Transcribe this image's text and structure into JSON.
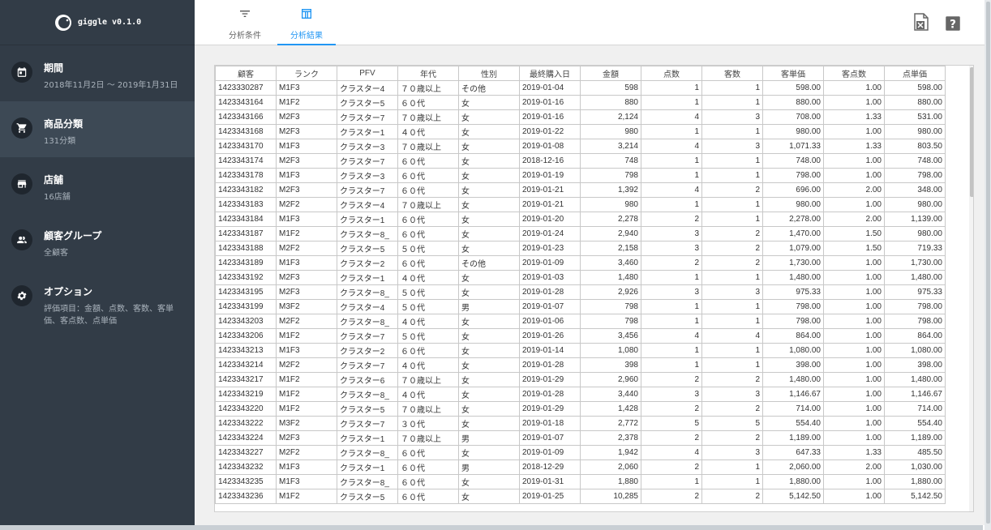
{
  "app": {
    "name": "giggle v0.1.0"
  },
  "sidebar": {
    "items": [
      {
        "label": "期間",
        "sub": "2018年11月2日 ～ 2019年1月31日",
        "icon": "calendar-icon"
      },
      {
        "label": "商品分類",
        "sub": "131分類",
        "icon": "cart-icon"
      },
      {
        "label": "店舗",
        "sub": "16店舗",
        "icon": "store-icon"
      },
      {
        "label": "顧客グループ",
        "sub": "全顧客",
        "icon": "people-icon"
      },
      {
        "label": "オプション",
        "sub": "評価項目：金額、点数、客数、客単価、客点数、点単価",
        "icon": "gear-icon"
      }
    ]
  },
  "tabs": [
    {
      "label": "分析条件",
      "icon": "filter-icon"
    },
    {
      "label": "分析結果",
      "icon": "table-icon"
    }
  ],
  "header_icons": [
    "excel-icon",
    "help-icon"
  ],
  "colors": {
    "sidebar": "#323c47",
    "accent": "#2196f3"
  },
  "table": {
    "headers": [
      "顧客",
      "ランク",
      "PFV",
      "年代",
      "性別",
      "最終購入日",
      "金額",
      "点数",
      "客数",
      "客単価",
      "客点数",
      "点単価"
    ],
    "rows": [
      [
        "1423330287",
        "M1F3",
        "クラスター4",
        "７０歳以上",
        "その他",
        "2019-01-04",
        "598",
        "1",
        "1",
        "598.00",
        "1.00",
        "598.00"
      ],
      [
        "1423343164",
        "M1F2",
        "クラスター5",
        "６０代",
        "女",
        "2019-01-16",
        "880",
        "1",
        "1",
        "880.00",
        "1.00",
        "880.00"
      ],
      [
        "1423343166",
        "M2F3",
        "クラスター7",
        "７０歳以上",
        "女",
        "2019-01-16",
        "2,124",
        "4",
        "3",
        "708.00",
        "1.33",
        "531.00"
      ],
      [
        "1423343168",
        "M2F3",
        "クラスター1",
        "４０代",
        "女",
        "2019-01-22",
        "980",
        "1",
        "1",
        "980.00",
        "1.00",
        "980.00"
      ],
      [
        "1423343170",
        "M1F3",
        "クラスター3",
        "７０歳以上",
        "女",
        "2019-01-08",
        "3,214",
        "4",
        "3",
        "1,071.33",
        "1.33",
        "803.50"
      ],
      [
        "1423343174",
        "M2F3",
        "クラスター7",
        "６０代",
        "女",
        "2018-12-16",
        "748",
        "1",
        "1",
        "748.00",
        "1.00",
        "748.00"
      ],
      [
        "1423343178",
        "M1F3",
        "クラスター3",
        "６０代",
        "女",
        "2019-01-19",
        "798",
        "1",
        "1",
        "798.00",
        "1.00",
        "798.00"
      ],
      [
        "1423343182",
        "M2F3",
        "クラスター7",
        "６０代",
        "女",
        "2019-01-21",
        "1,392",
        "4",
        "2",
        "696.00",
        "2.00",
        "348.00"
      ],
      [
        "1423343183",
        "M2F2",
        "クラスター4",
        "７０歳以上",
        "女",
        "2019-01-21",
        "980",
        "1",
        "1",
        "980.00",
        "1.00",
        "980.00"
      ],
      [
        "1423343184",
        "M1F3",
        "クラスター1",
        "６０代",
        "女",
        "2019-01-20",
        "2,278",
        "2",
        "1",
        "2,278.00",
        "2.00",
        "1,139.00"
      ],
      [
        "1423343187",
        "M1F2",
        "クラスター8_",
        "６０代",
        "女",
        "2019-01-24",
        "2,940",
        "3",
        "2",
        "1,470.00",
        "1.50",
        "980.00"
      ],
      [
        "1423343188",
        "M2F2",
        "クラスター5",
        "５０代",
        "女",
        "2019-01-23",
        "2,158",
        "3",
        "2",
        "1,079.00",
        "1.50",
        "719.33"
      ],
      [
        "1423343189",
        "M1F3",
        "クラスター2",
        "６０代",
        "その他",
        "2019-01-09",
        "3,460",
        "2",
        "2",
        "1,730.00",
        "1.00",
        "1,730.00"
      ],
      [
        "1423343192",
        "M2F3",
        "クラスター1",
        "４０代",
        "女",
        "2019-01-03",
        "1,480",
        "1",
        "1",
        "1,480.00",
        "1.00",
        "1,480.00"
      ],
      [
        "1423343195",
        "M2F3",
        "クラスター8_",
        "５０代",
        "女",
        "2019-01-28",
        "2,926",
        "3",
        "3",
        "975.33",
        "1.00",
        "975.33"
      ],
      [
        "1423343199",
        "M3F2",
        "クラスター4",
        "５０代",
        "男",
        "2019-01-07",
        "798",
        "1",
        "1",
        "798.00",
        "1.00",
        "798.00"
      ],
      [
        "1423343203",
        "M2F2",
        "クラスター8_",
        "４０代",
        "女",
        "2019-01-06",
        "798",
        "1",
        "1",
        "798.00",
        "1.00",
        "798.00"
      ],
      [
        "1423343206",
        "M1F2",
        "クラスター7",
        "５０代",
        "女",
        "2019-01-26",
        "3,456",
        "4",
        "4",
        "864.00",
        "1.00",
        "864.00"
      ],
      [
        "1423343213",
        "M1F3",
        "クラスター2",
        "６０代",
        "女",
        "2019-01-14",
        "1,080",
        "1",
        "1",
        "1,080.00",
        "1.00",
        "1,080.00"
      ],
      [
        "1423343214",
        "M2F2",
        "クラスター7",
        "４０代",
        "女",
        "2019-01-28",
        "398",
        "1",
        "1",
        "398.00",
        "1.00",
        "398.00"
      ],
      [
        "1423343217",
        "M1F2",
        "クラスター6",
        "７０歳以上",
        "女",
        "2019-01-29",
        "2,960",
        "2",
        "2",
        "1,480.00",
        "1.00",
        "1,480.00"
      ],
      [
        "1423343219",
        "M1F2",
        "クラスター8_",
        "４０代",
        "女",
        "2019-01-28",
        "3,440",
        "3",
        "3",
        "1,146.67",
        "1.00",
        "1,146.67"
      ],
      [
        "1423343220",
        "M1F2",
        "クラスター5",
        "７０歳以上",
        "女",
        "2019-01-29",
        "1,428",
        "2",
        "2",
        "714.00",
        "1.00",
        "714.00"
      ],
      [
        "1423343222",
        "M3F2",
        "クラスター7",
        "３０代",
        "女",
        "2019-01-18",
        "2,772",
        "5",
        "5",
        "554.40",
        "1.00",
        "554.40"
      ],
      [
        "1423343224",
        "M2F3",
        "クラスター1",
        "７０歳以上",
        "男",
        "2019-01-07",
        "2,378",
        "2",
        "2",
        "1,189.00",
        "1.00",
        "1,189.00"
      ],
      [
        "1423343227",
        "M2F2",
        "クラスター8_",
        "６０代",
        "女",
        "2019-01-09",
        "1,942",
        "4",
        "3",
        "647.33",
        "1.33",
        "485.50"
      ],
      [
        "1423343232",
        "M1F3",
        "クラスター1",
        "６０代",
        "男",
        "2018-12-29",
        "2,060",
        "2",
        "1",
        "2,060.00",
        "2.00",
        "1,030.00"
      ],
      [
        "1423343235",
        "M1F3",
        "クラスター8_",
        "６０代",
        "女",
        "2019-01-31",
        "1,880",
        "1",
        "1",
        "1,880.00",
        "1.00",
        "1,880.00"
      ],
      [
        "1423343236",
        "M1F2",
        "クラスター5",
        "６０代",
        "女",
        "2019-01-25",
        "10,285",
        "2",
        "2",
        "5,142.50",
        "1.00",
        "5,142.50"
      ]
    ]
  }
}
